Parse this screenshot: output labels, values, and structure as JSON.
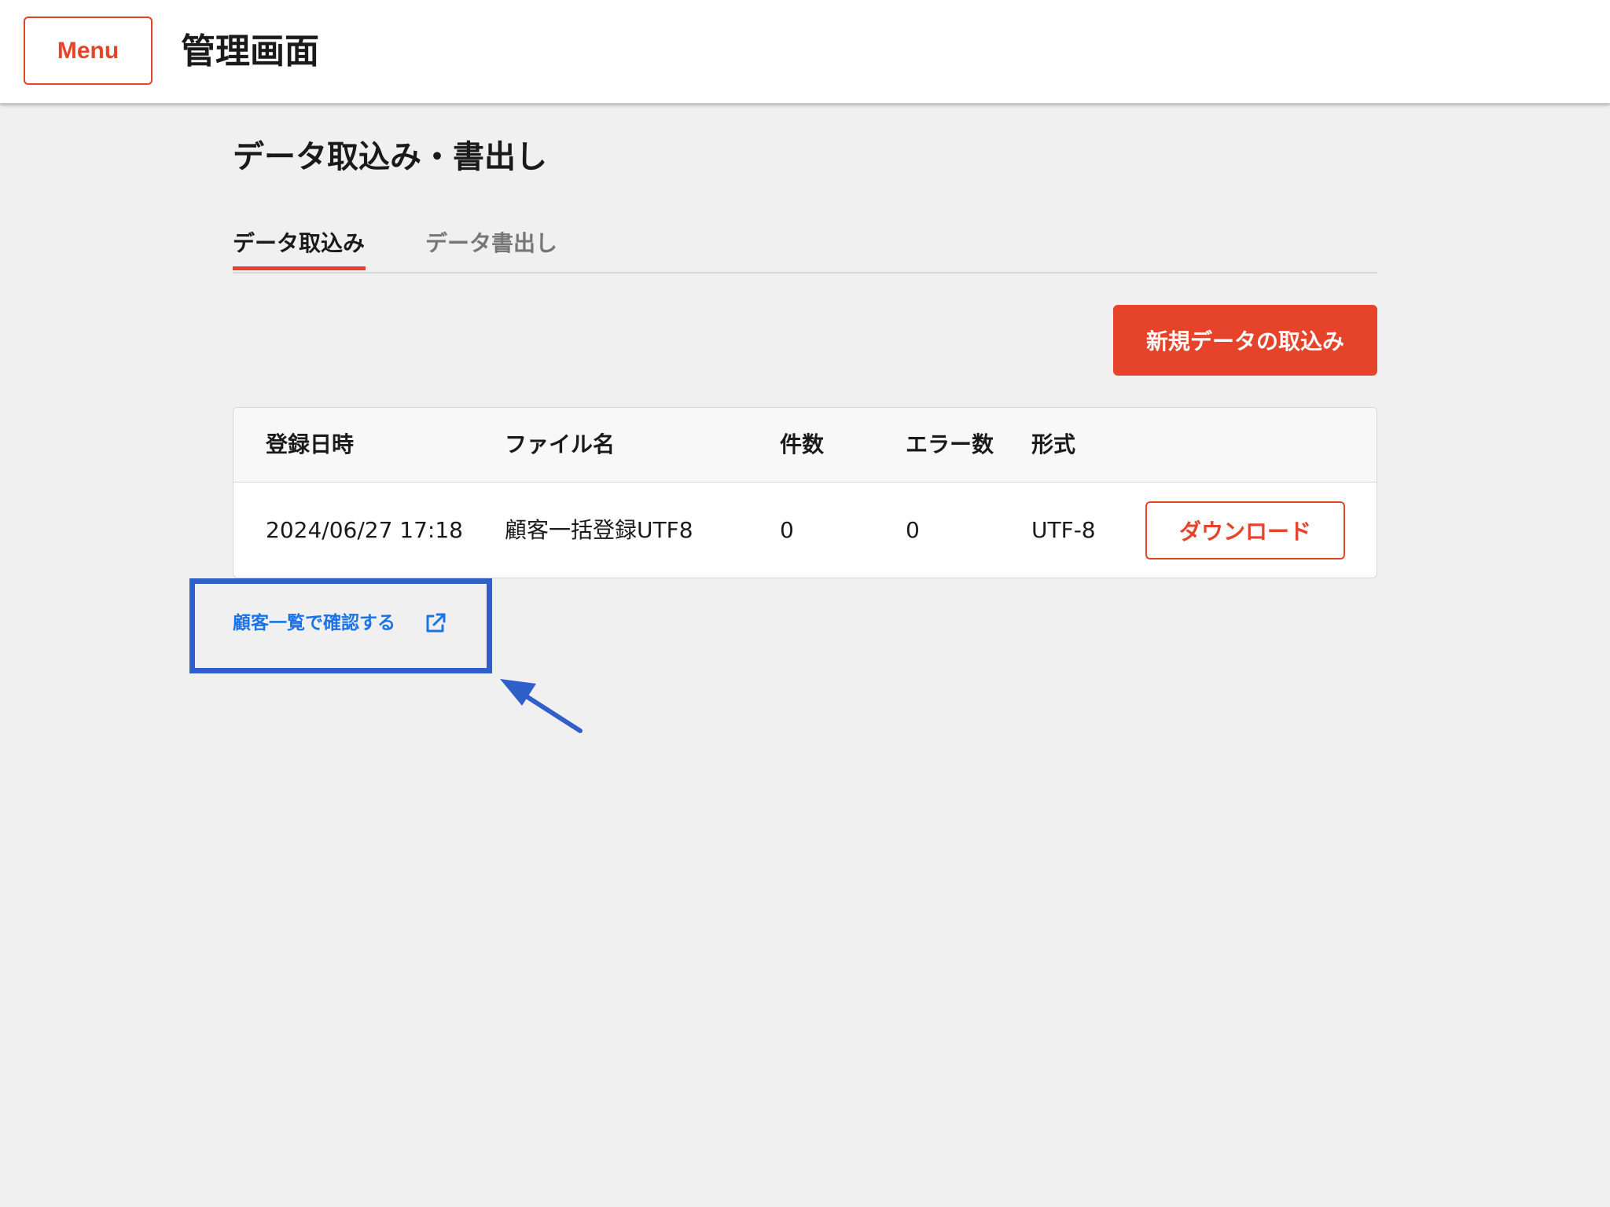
{
  "header": {
    "menu_label": "Menu",
    "app_title": "管理画面"
  },
  "page": {
    "title": "データ取込み・書出し"
  },
  "tabs": [
    {
      "label": "データ取込み",
      "active": true
    },
    {
      "label": "データ書出し",
      "active": false
    }
  ],
  "actions": {
    "new_import_label": "新規データの取込み"
  },
  "table": {
    "columns": [
      "登録日時",
      "ファイル名",
      "件数",
      "エラー数",
      "形式"
    ],
    "rows": [
      {
        "date": "2024/06/27 17:18",
        "file": "顧客一括登録UTF8",
        "count": "0",
        "errors": "0",
        "format": "UTF-8",
        "download_label": "ダウンロード"
      }
    ]
  },
  "link": {
    "label": "顧客一覧で確認する",
    "icon": "external-link-icon"
  },
  "colors": {
    "accent": "#e5432a",
    "link": "#1a73e8",
    "annotation": "#2f5fc9"
  }
}
